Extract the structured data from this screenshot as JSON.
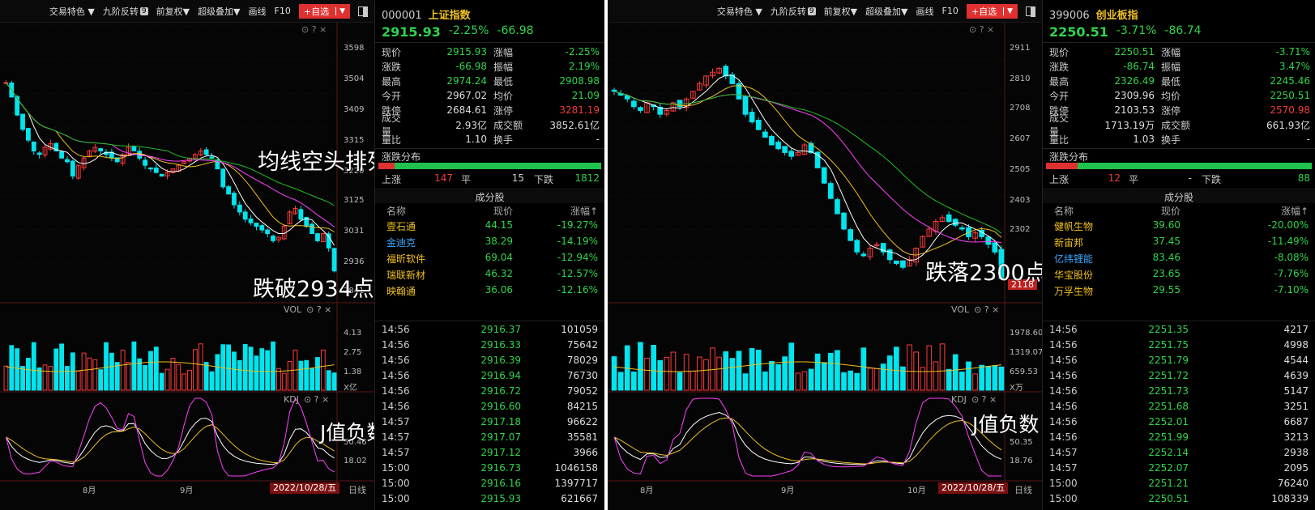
{
  "toolbar": {
    "items": [
      "交易特色 ▼",
      "九阶反转",
      "前复权▼",
      "超级叠加▼",
      "画线",
      "F10"
    ],
    "badge": "9",
    "add_label": "+自选",
    "add_dropdown": "▼"
  },
  "left": {
    "chart_icons": "⊙ ? ×",
    "vol_label": "VOL",
    "kdj_label": "KDJ",
    "overlays": [
      "均线空头排列",
      "跌破2934点",
      "J值负数"
    ],
    "price_ticks": [
      "3598",
      "3504",
      "3409",
      "3315",
      "3220",
      "3125",
      "3031",
      "2936",
      "2841"
    ],
    "vol_ticks": [
      "4.13",
      "2.75",
      "1.38",
      "X亿"
    ],
    "kdj_ticks": [
      "50.46",
      "18.02"
    ],
    "x_ticks": [
      "8月",
      "9月"
    ],
    "date": "2022/10/28/五",
    "bottom_tab": "日线"
  },
  "right": {
    "chart_icons": "⊙ ? ×",
    "vol_label": "VOL",
    "kdj_label": "KDJ",
    "overlays": [
      "跌落2300点",
      "J值负数"
    ],
    "price_ticks": [
      "2911",
      "2810",
      "2708",
      "2607",
      "2505",
      "2403",
      "2302"
    ],
    "price_tag": "2118",
    "vol_ticks": [
      "1978.60",
      "1319.07",
      "659.53",
      "X万"
    ],
    "kdj_ticks": [
      "50.35",
      "18.76"
    ],
    "x_ticks": [
      "8月",
      "9月",
      "10月"
    ],
    "date": "2022/10/28/五",
    "bottom_tab": "日线"
  },
  "info_left": {
    "code": "000001",
    "name": "上证指数",
    "price": "2915.93",
    "pct": "-2.25%",
    "chg": "-66.98",
    "quote": [
      [
        "现价",
        "2915.93",
        "涨幅",
        "-2.25%"
      ],
      [
        "涨跌",
        "-66.98",
        "振幅",
        "2.19%"
      ],
      [
        "最高",
        "2974.24",
        "最低",
        "2908.98"
      ],
      [
        "今开",
        "2967.02",
        "均价",
        "21.09"
      ],
      [
        "跌停",
        "2684.61",
        "涨停",
        "3281.19"
      ],
      [
        "成交量",
        "2.93亿",
        "成交额",
        "3852.61亿"
      ],
      [
        "量比",
        "1.10",
        "换手",
        "-"
      ]
    ],
    "dist_title": "涨跌分布",
    "dist": {
      "up_label": "上涨",
      "up": "147",
      "flat_label": "平",
      "flat": "15",
      "down_label": "下跌",
      "down": "1812",
      "up_ratio": 0.074
    },
    "comp_title": "成分股",
    "comp_hdr": [
      "名称",
      "现价",
      "涨幅↑"
    ],
    "comp": [
      {
        "name": "壹石通",
        "price": "44.15",
        "pct": "-19.27%",
        "color": "#f0c020"
      },
      {
        "name": "金迪克",
        "price": "38.29",
        "pct": "-14.19%",
        "color": "#39a8ff"
      },
      {
        "name": "福昕软件",
        "price": "69.04",
        "pct": "-12.94%",
        "color": "#f0c020"
      },
      {
        "name": "瑞联新材",
        "price": "46.32",
        "pct": "-12.57%",
        "color": "#f0c020"
      },
      {
        "name": "映翰通",
        "price": "36.06",
        "pct": "-12.16%",
        "color": "#f0c020"
      }
    ],
    "ticks": [
      [
        "14:56",
        "2916.37",
        "101059"
      ],
      [
        "14:56",
        "2916.33",
        "75642"
      ],
      [
        "14:56",
        "2916.39",
        "78029"
      ],
      [
        "14:56",
        "2916.94",
        "76730"
      ],
      [
        "14:56",
        "2916.72",
        "79052"
      ],
      [
        "14:56",
        "2916.60",
        "84215"
      ],
      [
        "14:57",
        "2917.18",
        "96622"
      ],
      [
        "14:57",
        "2917.07",
        "35581"
      ],
      [
        "14:57",
        "2917.12",
        "3966"
      ],
      [
        "15:00",
        "2916.73",
        "1046158"
      ],
      [
        "15:00",
        "2916.16",
        "1397717"
      ],
      [
        "15:00",
        "2915.93",
        "621667"
      ]
    ]
  },
  "info_right": {
    "code": "399006",
    "name": "创业板指",
    "price": "2250.51",
    "pct": "-3.71%",
    "chg": "-86.74",
    "quote": [
      [
        "现价",
        "2250.51",
        "涨幅",
        "-3.71%"
      ],
      [
        "涨跌",
        "-86.74",
        "振幅",
        "3.47%"
      ],
      [
        "最高",
        "2326.49",
        "最低",
        "2245.46"
      ],
      [
        "今开",
        "2309.96",
        "均价",
        "2250.51"
      ],
      [
        "跌停",
        "2103.53",
        "涨停",
        "2570.98"
      ],
      [
        "成交量",
        "1713.19万",
        "成交额",
        "661.93亿"
      ],
      [
        "量比",
        "1.03",
        "换手",
        "-"
      ]
    ],
    "dist_title": "涨跌分布",
    "dist": {
      "up_label": "上涨",
      "up": "12",
      "flat_label": "平",
      "flat": "-",
      "down_label": "下跌",
      "down": "88",
      "up_ratio": 0.12
    },
    "comp_title": "成分股",
    "comp_hdr": [
      "名称",
      "现价",
      "涨幅↑"
    ],
    "comp": [
      {
        "name": "健帆生物",
        "price": "39.60",
        "pct": "-20.00%",
        "color": "#f0c020"
      },
      {
        "name": "新宙邦",
        "price": "37.45",
        "pct": "-11.49%",
        "color": "#f0c020"
      },
      {
        "name": "亿纬锂能",
        "price": "83.46",
        "pct": "-8.08%",
        "color": "#39a8ff"
      },
      {
        "name": "华宝股份",
        "price": "23.65",
        "pct": "-7.76%",
        "color": "#f0c020"
      },
      {
        "name": "万孚生物",
        "price": "29.55",
        "pct": "-7.10%",
        "color": "#f0c020"
      }
    ],
    "ticks": [
      [
        "14:56",
        "2251.35",
        "4217"
      ],
      [
        "14:56",
        "2251.75",
        "4998"
      ],
      [
        "14:56",
        "2251.79",
        "4544"
      ],
      [
        "14:56",
        "2251.72",
        "4639"
      ],
      [
        "14:56",
        "2251.73",
        "5147"
      ],
      [
        "14:56",
        "2251.68",
        "3251"
      ],
      [
        "14:56",
        "2252.01",
        "6687"
      ],
      [
        "14:56",
        "2251.99",
        "3213"
      ],
      [
        "14:57",
        "2252.14",
        "2938"
      ],
      [
        "14:57",
        "2252.07",
        "2095"
      ],
      [
        "15:00",
        "2251.21",
        "76240"
      ],
      [
        "15:00",
        "2250.51",
        "108339"
      ]
    ]
  },
  "chart_data": [
    {
      "type": "line",
      "title": "上证指数",
      "ylim": [
        2841,
        3598
      ],
      "x_ticks": [
        "8月",
        "9月"
      ],
      "series": [
        {
          "values": [
            3440,
            3400,
            3350,
            3310,
            3280,
            3250,
            3240,
            3260,
            3270,
            3250,
            3230,
            3220,
            3180,
            3210,
            3230,
            3250,
            3260,
            3250,
            3240,
            3230,
            3220,
            3240,
            3260,
            3250,
            3230,
            3210,
            3200,
            3190,
            3180,
            3190,
            3200,
            3210,
            3220,
            3230,
            3240,
            3250,
            3240,
            3230,
            3200,
            3150,
            3130,
            3100,
            3080,
            3060,
            3050,
            3040,
            3030,
            3020,
            3000,
            3010,
            3040,
            3080,
            3090,
            3060,
            3040,
            3020,
            3000,
            3020,
            2980,
            2916
          ]
        }
      ]
    },
    {
      "type": "line",
      "title": "创业板指",
      "ylim": [
        2200,
        2911
      ],
      "x_ticks": [
        "8月",
        "9月",
        "10月"
      ],
      "series": [
        {
          "values": [
            2740,
            2730,
            2720,
            2700,
            2690,
            2710,
            2700,
            2680,
            2690,
            2710,
            2700,
            2720,
            2740,
            2760,
            2780,
            2790,
            2800,
            2780,
            2760,
            2720,
            2680,
            2660,
            2640,
            2620,
            2600,
            2590,
            2580,
            2570,
            2580,
            2600,
            2580,
            2540,
            2500,
            2460,
            2420,
            2380,
            2350,
            2320,
            2310,
            2330,
            2340,
            2320,
            2300,
            2290,
            2280,
            2300,
            2330,
            2360,
            2380,
            2400,
            2410,
            2400,
            2390,
            2380,
            2360,
            2370,
            2360,
            2340,
            2320,
            2250
          ]
        }
      ]
    }
  ]
}
